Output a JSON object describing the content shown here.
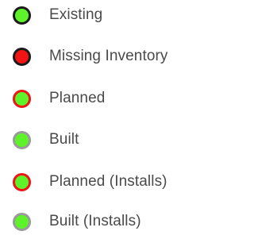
{
  "legend": {
    "items": [
      {
        "label": "Existing",
        "icon": "green-circle-dark-border-icon",
        "fill": "#5ef22b",
        "border": "#1a1a1a"
      },
      {
        "label": "Missing Inventory",
        "icon": "red-circle-dark-border-icon",
        "fill": "#f01414",
        "border": "#1a1a1a"
      },
      {
        "label": "Planned",
        "icon": "green-circle-red-border-icon",
        "fill": "#5ef22b",
        "border": "#f01414"
      },
      {
        "label": "Built",
        "icon": "green-circle-gray-border-icon",
        "fill": "#5ef22b",
        "border": "#9a9a9a"
      },
      {
        "label": "Planned (Installs)",
        "icon": "green-circle-red-border-icon",
        "fill": "#5ef22b",
        "border": "#f01414"
      },
      {
        "label": "Built (Installs)",
        "icon": "green-circle-gray-border-icon",
        "fill": "#5ef22b",
        "border": "#9a9a9a"
      }
    ]
  }
}
